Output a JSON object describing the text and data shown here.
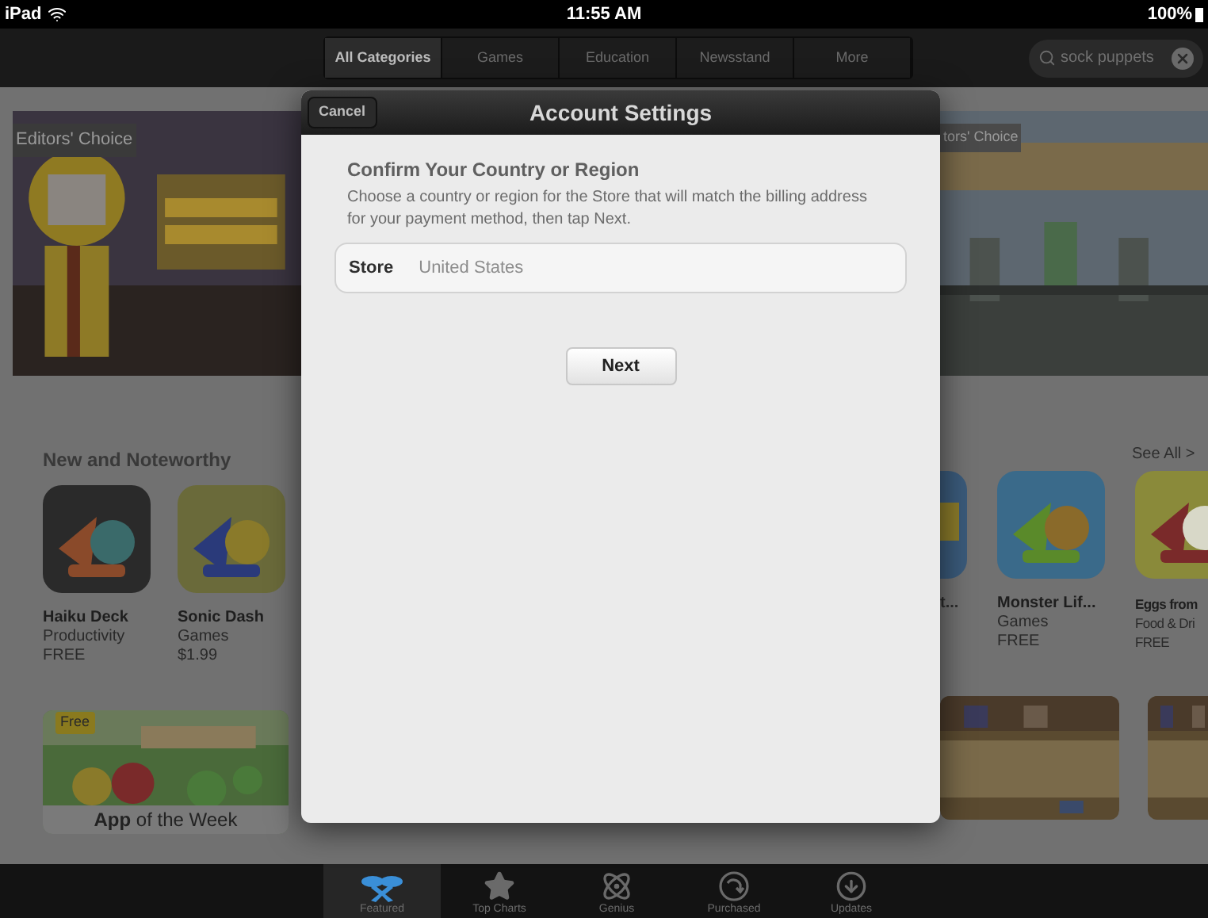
{
  "status_bar": {
    "device": "iPad",
    "time": "11:55 AM",
    "battery": "100%"
  },
  "nav": {
    "segments": [
      {
        "label": "All Categories",
        "selected": true
      },
      {
        "label": "Games",
        "selected": false
      },
      {
        "label": "Education",
        "selected": false
      },
      {
        "label": "Newsstand",
        "selected": false
      },
      {
        "label": "More",
        "selected": false
      }
    ],
    "search": {
      "value": "sock puppets"
    }
  },
  "banners": [
    {
      "badge": "Editors' Choice"
    },
    {
      "badge": "tors' Choice"
    }
  ],
  "new_and_noteworthy": {
    "title": "New and Noteworthy",
    "see_all": "See All >",
    "apps_left": [
      {
        "name": "Haiku Deck",
        "category": "Productivity",
        "price": "FREE"
      },
      {
        "name": "Sonic Dash",
        "category": "Games",
        "price": "$1.99"
      }
    ],
    "apps_right": [
      {
        "name": "t..."
      },
      {
        "name": "Monster Lif...",
        "category": "Games",
        "price": "FREE"
      },
      {
        "name": "Eggs from",
        "category": "Food & Dri",
        "price": "FREE"
      }
    ]
  },
  "app_of_week": {
    "badge": "Free",
    "caption": "**App** of the Week"
  },
  "modal": {
    "cancel": "Cancel",
    "title": "Account Settings",
    "heading": "Confirm Your Country or Region",
    "description": "Choose a country or region for the Store that will match the billing address for your payment method, then tap Next.",
    "field": {
      "label": "Store",
      "value": "United States"
    },
    "next": "Next"
  },
  "tab_bar": [
    {
      "label": "Featured",
      "selected": true
    },
    {
      "label": "Top Charts",
      "selected": false
    },
    {
      "label": "Genius",
      "selected": false
    },
    {
      "label": "Purchased",
      "selected": false
    },
    {
      "label": "Updates",
      "selected": false
    }
  ]
}
